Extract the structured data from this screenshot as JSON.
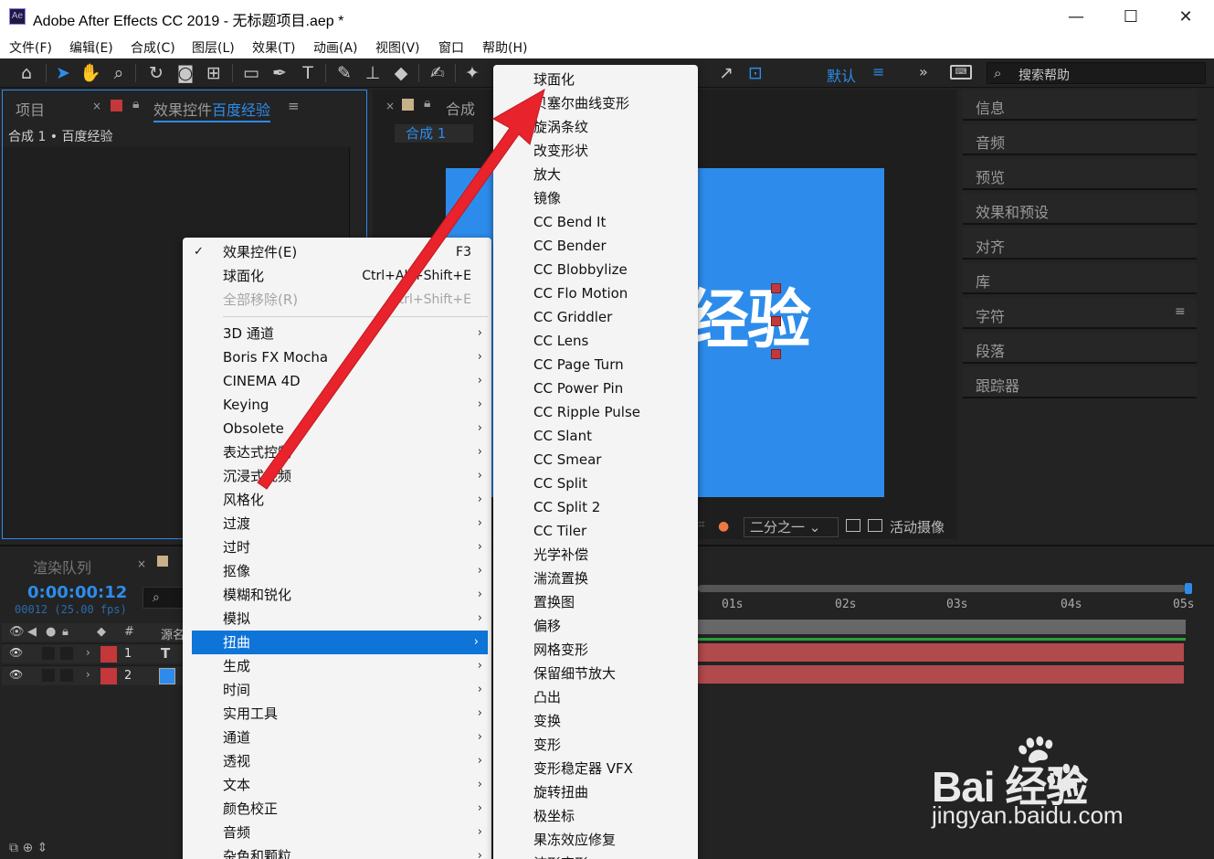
{
  "window": {
    "app_icon": "Ae",
    "title": "Adobe After Effects CC 2019 - 无标题项目.aep *",
    "minimize": "—",
    "maximize": "☐",
    "close": "✕"
  },
  "menubar": [
    "文件(F)",
    "编辑(E)",
    "合成(C)",
    "图层(L)",
    "效果(T)",
    "动画(A)",
    "视图(V)",
    "窗口",
    "帮助(H)"
  ],
  "toolbar": {
    "workspace": "默认",
    "workspace_menu": "≡",
    "more": "»",
    "search_placeholder": "搜索帮助"
  },
  "project_panel": {
    "tab_project": "项目",
    "tab_close": "×",
    "tab_effects_prefix": "效果控件",
    "tab_effects_layer": "百度经验",
    "panel_menu": "≡",
    "breadcrumb": "合成 1 • 百度经验"
  },
  "comp_panel": {
    "tab_close": "×",
    "tab_title": "合成",
    "comp_chip": "合成 1",
    "canvas_text": "经验",
    "canvas_color": "#2d8ceb",
    "zoom": "二分之一",
    "camera": "活动摄像"
  },
  "right_panels": [
    "信息",
    "音频",
    "预览",
    "效果和预设",
    "对齐",
    "库",
    "字符",
    "段落",
    "跟踪器"
  ],
  "right_panel_menu": "≡",
  "timeline": {
    "tab_render_queue": "渲染队列",
    "tab_close": "×",
    "timecode": "0:00:00:12",
    "frames": "00012 (25.00 fps)",
    "search_icon": "⌕",
    "col_number": "#",
    "col_source": "源名",
    "ruler_ticks": [
      "01s",
      "02s",
      "03s",
      "04s",
      "05s"
    ],
    "layers": [
      {
        "number": "1",
        "type": "T"
      },
      {
        "number": "2",
        "type": ""
      }
    ],
    "track_color": "#b14a4c",
    "label_color": "#c3383a"
  },
  "watermark": {
    "brand": "Bai  经验",
    "url": "jingyan.baidu.com"
  },
  "context_menu": {
    "items": [
      {
        "label": "效果控件(E)",
        "shortcut": "F3",
        "checked": true
      },
      {
        "label": "球面化",
        "shortcut": "Ctrl+Alt+Shift+E"
      },
      {
        "label": "全部移除(R)",
        "shortcut": "Ctrl+Shift+E",
        "disabled": true
      }
    ],
    "categories": [
      "3D 通道",
      "Boris FX Mocha",
      "CINEMA 4D",
      "Keying",
      "Obsolete",
      "表达式控制",
      "沉浸式视频",
      "风格化",
      "过渡",
      "过时",
      "抠像",
      "模糊和锐化",
      "模拟",
      "扭曲",
      "生成",
      "时间",
      "实用工具",
      "通道",
      "透视",
      "文本",
      "颜色校正",
      "音频",
      "杂色和颗粒"
    ],
    "highlighted": "扭曲",
    "chevron": "›",
    "check": "✓"
  },
  "distort_submenu": [
    "球面化",
    "贝塞尔曲线变形",
    "旋涡条纹",
    "改变形状",
    "放大",
    "镜像",
    "CC Bend It",
    "CC Bender",
    "CC Blobbylize",
    "CC Flo Motion",
    "CC Griddler",
    "CC Lens",
    "CC Page Turn",
    "CC Power Pin",
    "CC Ripple Pulse",
    "CC Slant",
    "CC Smear",
    "CC Split",
    "CC Split 2",
    "CC Tiler",
    "光学补偿",
    "湍流置换",
    "置换图",
    "偏移",
    "网格变形",
    "保留细节放大",
    "凸出",
    "变换",
    "变形",
    "变形稳定器 VFX",
    "旋转扭曲",
    "极坐标",
    "果冻效应修复",
    "波形变形"
  ],
  "annotation": {
    "color": "#e8232b"
  }
}
